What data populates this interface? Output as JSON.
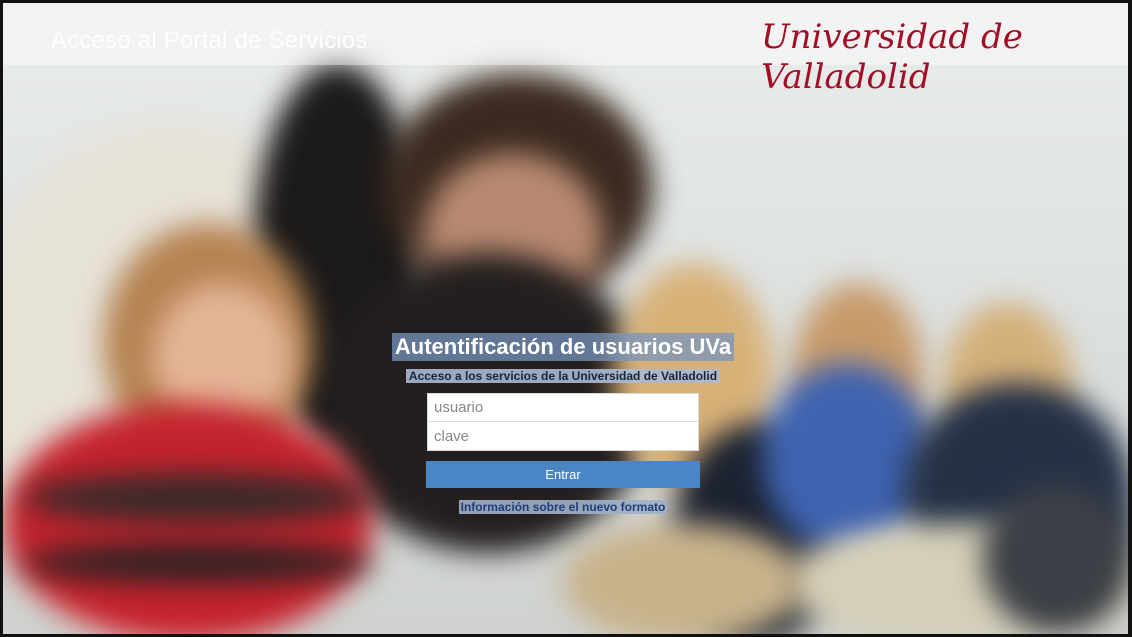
{
  "header": {
    "portal_title": "Acceso al Portal de Servicios",
    "logo_text": "Universidad de Valladolid"
  },
  "login": {
    "title": "Autentificación de usuarios UVa",
    "subtitle": "Acceso a los servicios de la Universidad de Valladolid",
    "username_placeholder": "usuario",
    "password_placeholder": "clave",
    "submit_label": "Entrar",
    "info_link": "Información sobre el nuevo formato"
  },
  "colors": {
    "logo": "#a30e26",
    "button": "#4a86c6"
  }
}
